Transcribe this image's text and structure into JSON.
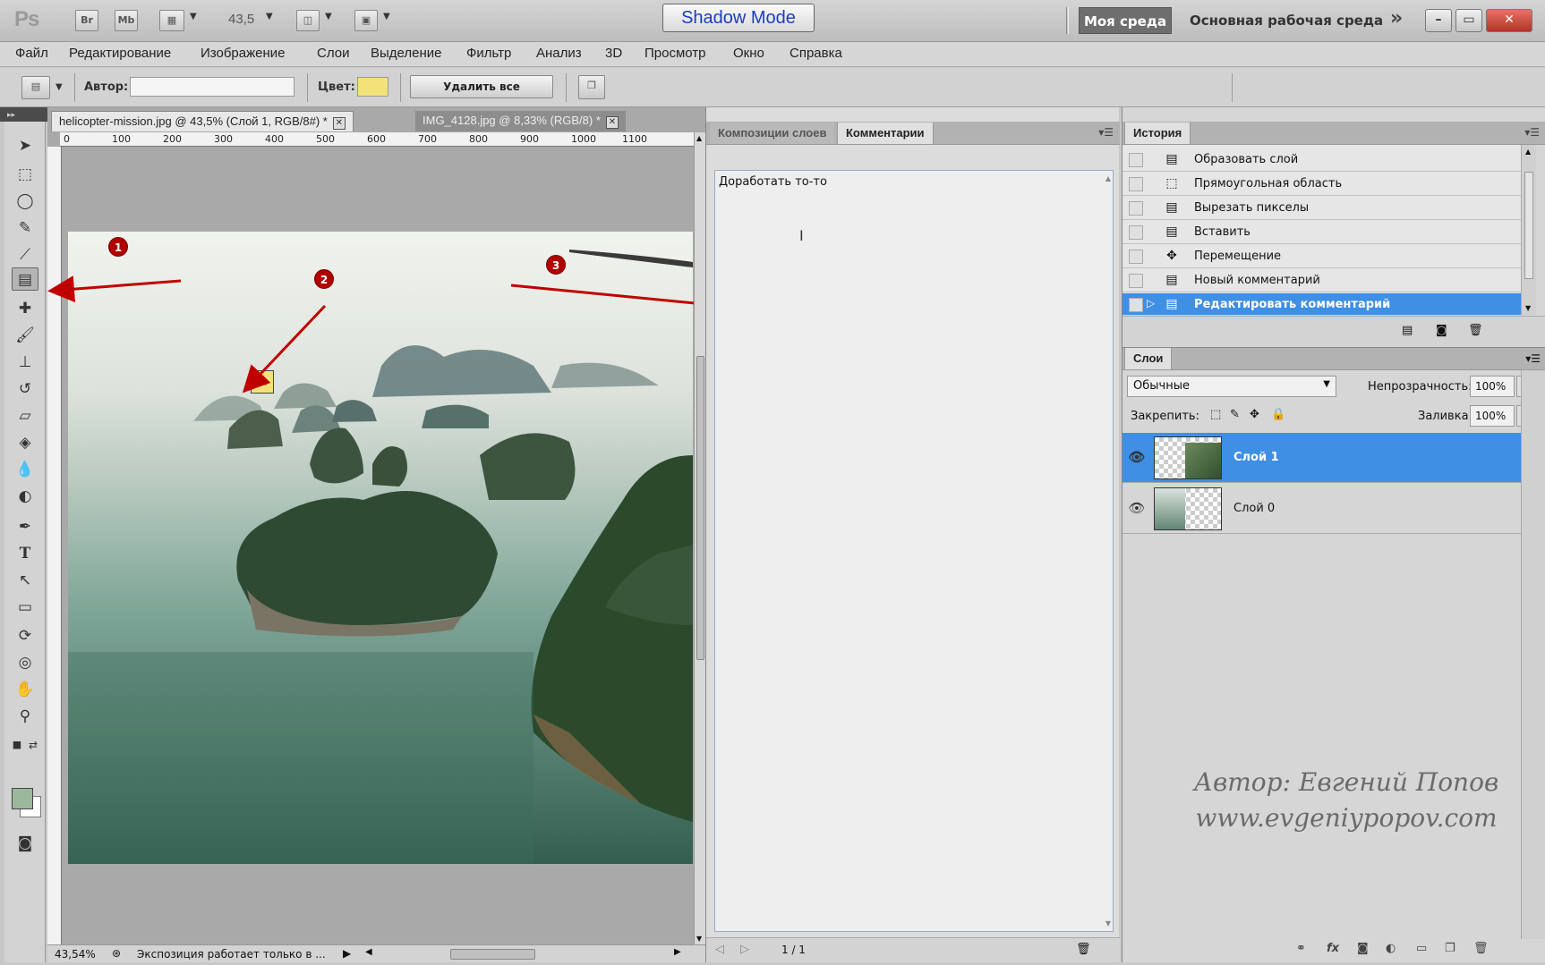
{
  "app": {
    "logo": "Ps",
    "bridge": "Br",
    "minibridge": "Mb",
    "zoom": "43,5",
    "shadow_mode": "Shadow Mode",
    "workspace_active": "Моя среда",
    "workspace_main": "Основная рабочая среда",
    "more": "»"
  },
  "menu": [
    "Файл",
    "Редактирование",
    "Изображение",
    "Слои",
    "Выделение",
    "Фильтр",
    "Анализ",
    "3D",
    "Просмотр",
    "Окно",
    "Справка"
  ],
  "options": {
    "author_label": "Автор:",
    "author_value": "",
    "color_label": "Цвет:",
    "color_value": "#f3e27a",
    "clear_all": "Удалить все"
  },
  "tabs": [
    {
      "label": "helicopter-mission.jpg @ 43,5% (Слой 1, RGB/8#) *",
      "active": true
    },
    {
      "label": "IMG_4128.jpg @ 8,33% (RGB/8) *",
      "active": false
    }
  ],
  "ruler": [
    "0",
    "100",
    "200",
    "300",
    "400",
    "500",
    "600",
    "700",
    "800",
    "900",
    "1000",
    "1100"
  ],
  "markers": [
    "1",
    "2",
    "3"
  ],
  "status": {
    "zoom": "43,54%",
    "text": "Экспозиция работает только в ..."
  },
  "comments_panel": {
    "tab_compositions": "Композиции слоев",
    "tab_comments": "Комментарии",
    "comment_text": "Доработать то-то",
    "page": "1 / 1"
  },
  "history": {
    "title": "История",
    "items": [
      {
        "label": "Образовать слой",
        "icon": "doc-icon"
      },
      {
        "label": "Прямоугольная область",
        "icon": "marquee-icon"
      },
      {
        "label": "Вырезать пикселы",
        "icon": "doc-icon"
      },
      {
        "label": "Вставить",
        "icon": "doc-icon"
      },
      {
        "label": "Перемещение",
        "icon": "move-icon"
      },
      {
        "label": "Новый комментарий",
        "icon": "doc-icon"
      },
      {
        "label": "Редактировать комментарий",
        "icon": "doc-icon",
        "active": true
      }
    ]
  },
  "layers": {
    "title": "Слои",
    "blend_mode": "Обычные",
    "opacity_label": "Непрозрачность:",
    "opacity": "100%",
    "lock_label": "Закрепить:",
    "fill_label": "Заливка:",
    "fill": "100%",
    "items": [
      {
        "name": "Слой 1",
        "active": true
      },
      {
        "name": "Слой 0",
        "active": false
      }
    ]
  },
  "watermark": {
    "line1": "Автор: Евгений Попов",
    "line2": "www.evgeniypopov.com"
  },
  "colors": {
    "selection": "#3f8fe4",
    "marker": "#b00000",
    "swatch_fg": "#9cb89c"
  }
}
